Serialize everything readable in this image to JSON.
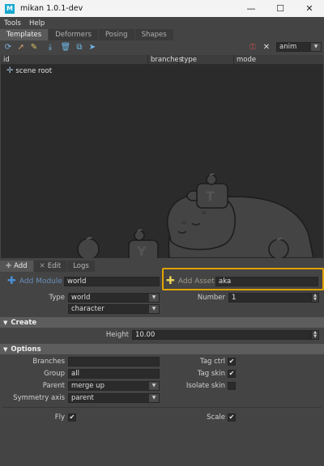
{
  "window": {
    "title": "mikan 1.0.1-dev",
    "app_icon": "M"
  },
  "menu": [
    "Tools",
    "Help"
  ],
  "tabs": [
    "Templates",
    "Deformers",
    "Posing",
    "Shapes"
  ],
  "toolbar": {
    "mode_value": "anim"
  },
  "tree": {
    "columns": [
      "id",
      "branches",
      "type",
      "mode"
    ],
    "rows": [
      {
        "label": "scene root"
      }
    ]
  },
  "lower_tabs": [
    "Add",
    "Edit",
    "Logs"
  ],
  "add": {
    "module_label": "Add Module",
    "module_value": "world",
    "asset_label": "Add Asset",
    "asset_value": "aka",
    "type_label": "Type",
    "type_value": "world",
    "subtype_value": "character",
    "number_label": "Number",
    "number_value": "1"
  },
  "create": {
    "title": "Create",
    "height_label": "Height",
    "height_value": "10.00"
  },
  "options": {
    "title": "Options",
    "branches_label": "Branches",
    "branches_value": "",
    "group_label": "Group",
    "group_value": "all",
    "parent_label": "Parent",
    "parent_value": "merge up",
    "symmetry_label": "Symmetry axis",
    "symmetry_value": "parent",
    "tag_ctrl_label": "Tag ctrl",
    "tag_ctrl": true,
    "tag_skin_label": "Tag skin",
    "tag_skin": true,
    "isolate_skin_label": "Isolate skin",
    "isolate_skin": false,
    "fly_label": "Fly",
    "fly": true,
    "scale_label": "Scale",
    "scale": true
  },
  "colors": {
    "accent": "#6a8fba",
    "highlight": "#e0a300",
    "add_asset_plus": "#e8d25a"
  }
}
